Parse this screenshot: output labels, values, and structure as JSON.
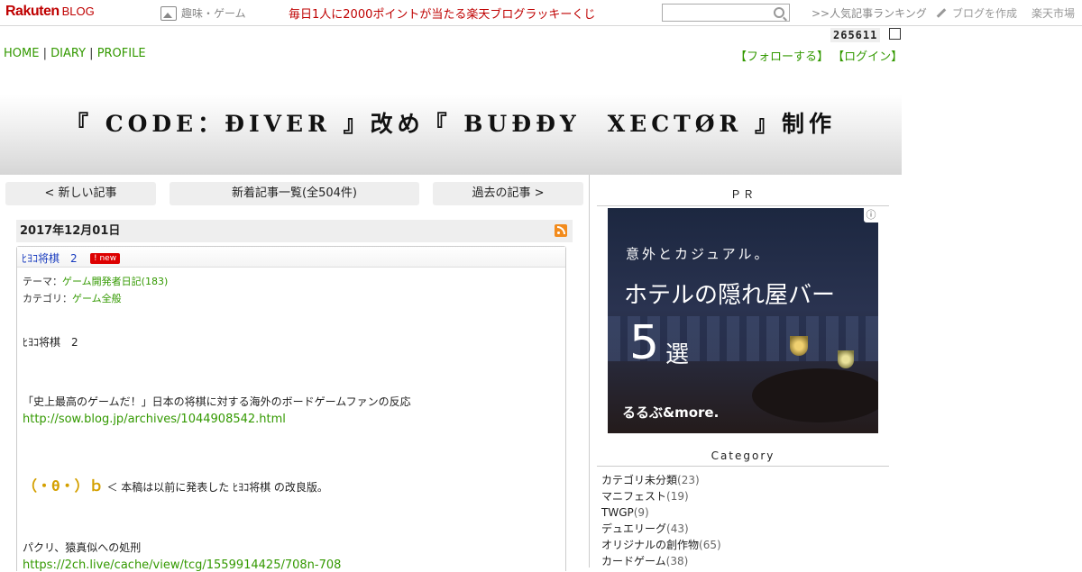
{
  "topbar": {
    "logo_brand": "Rakuten",
    "logo_product": "BLOG",
    "category": "趣味・ゲーム",
    "lottery": "毎日1人に2000ポイントが当たる楽天ブログラッキーくじ",
    "search_placeholder": "",
    "ranking": ">>人気記事ランキング",
    "create": "ブログを作成",
    "ichiba": "楽天市場"
  },
  "counter": "265611",
  "nav": {
    "home": "HOME",
    "diary": "DIARY",
    "profile": "PROFILE",
    "sep": "|",
    "follow": "【フォローする】",
    "login": "【ログイン】"
  },
  "blog_title": "『 CODE：ĐIVER 』改め『 BUĐĐY　XECTØR 』制作",
  "pager": {
    "newer": "< 新しい記事",
    "list": "新着記事一覧(全504件)",
    "older": "過去の記事 >"
  },
  "entry": {
    "date": "2017年12月01日",
    "title": "ﾋﾖｺ将棋　2",
    "badge": "new",
    "theme_label": "テーマ：",
    "theme_value": "ゲーム開発者日記(183)",
    "category_label": "カテゴリ：",
    "category_value": "ゲーム全般",
    "line1": "ﾋﾖｺ将棋　2",
    "line2": "「史上最高のゲームだ！」日本の将棋に対する海外のボードゲームファンの反応",
    "link1": "http://sow.blog.jp/archives/1044908542.html",
    "face": "（・θ・）ｂ",
    "line3": "＜ 本稿は以前に発表した ﾋﾖｺ将棋 の改良版。",
    "line4": "パクリ、猿真似への処刑",
    "link2": "https://2ch.live/cache/view/tcg/1559914425/708n-708"
  },
  "sidebar": {
    "pr_head": "ＰＲ",
    "ad": {
      "sub": "意外とカジュアル。",
      "main": "ホテルの隠れ屋バー",
      "num": "5",
      "sen": "選",
      "brand": "るるぶ&more.",
      "info": "ⓘ"
    },
    "category_head": "Category",
    "categories": [
      {
        "name": "カテゴリ未分類",
        "count": "(23)"
      },
      {
        "name": "マニフェスト",
        "count": "(19)"
      },
      {
        "name": "TWGP",
        "count": "(9)"
      },
      {
        "name": "デュエリーグ",
        "count": "(43)"
      },
      {
        "name": "オリジナルの創作物",
        "count": "(65)"
      },
      {
        "name": "カードゲーム",
        "count": "(38)"
      }
    ]
  },
  "colors": {
    "brand_red": "#bf0000",
    "link_green": "#339900",
    "title_blue": "#1a3dbf"
  }
}
